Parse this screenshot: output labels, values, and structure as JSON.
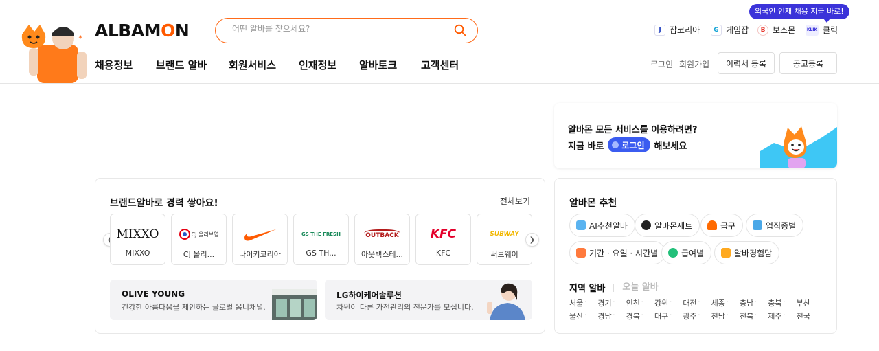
{
  "header": {
    "logo": "ALBAMON",
    "search_placeholder": "어떤 알바를 찾으세요?",
    "promo_badge": "외국인 인재 채용 지금 바로!",
    "family_sites": [
      {
        "label": "잡코리아",
        "icon": "jobkorea-icon",
        "color": "#1f3fbf",
        "glyph": "J"
      },
      {
        "label": "게임잡",
        "icon": "gamejob-icon",
        "color": "#15a4d6",
        "glyph": "G"
      },
      {
        "label": "보스몬",
        "icon": "bossmon-icon",
        "color": "#e8342b",
        "glyph": "B"
      },
      {
        "label": "클릭",
        "icon": "klik-icon",
        "color": "#3b33d9",
        "glyph": "KLIK"
      }
    ],
    "nav": [
      "채용정보",
      "브랜드 알바",
      "회원서비스",
      "인재정보",
      "알바토크",
      "고객센터"
    ],
    "login_link": "로그인",
    "signup_link": "회원가입",
    "resume_button": "이력서 등록",
    "post_button": "공고등록"
  },
  "login_card": {
    "line1": "알바몬 모든 서비스를 이용하려면?",
    "line2_before": "지금 바로",
    "login_pill": "로그인",
    "line2_after": "해보세요"
  },
  "brand_section": {
    "title": "브랜드알바로 경력 쌓아요!",
    "more": "전체보기",
    "brands": [
      {
        "name": "MIXXO",
        "logo_text": "MIXXO"
      },
      {
        "name": "CJ 올리...",
        "logo_text": "CJ 올리브영"
      },
      {
        "name": "나이키코리아",
        "logo_text": "nike-swoosh"
      },
      {
        "name": "GS TH...",
        "logo_text": "GS THE FRESH"
      },
      {
        "name": "아웃백스테...",
        "logo_text": "OUTBACK"
      },
      {
        "name": "KFC",
        "logo_text": "KFC"
      },
      {
        "name": "써브웨이",
        "logo_text": "SUBWAY"
      }
    ],
    "banners": [
      {
        "title": "OLIVE YOUNG",
        "subtitle": "건강한 아름다움을 제안하는 글로벌 옴니채널."
      },
      {
        "title": "LG하이케어솔루션",
        "subtitle": "차원이 다른 가전관리의 전문가를 모십니다."
      }
    ]
  },
  "recommend": {
    "title": "알바몬 추천",
    "chips": [
      {
        "label": "AI추천알바",
        "icon": "ai-monitor-icon",
        "color": "#5ab3f0"
      },
      {
        "label": "알바몬제트",
        "icon": "jet-icon",
        "color": "#222222"
      },
      {
        "label": "급구",
        "icon": "siren-icon",
        "color": "#ff6a00"
      },
      {
        "label": "업직종별",
        "icon": "briefcase-icon",
        "color": "#4aa8e8"
      },
      {
        "label": "기간 · 요일 · 시간별",
        "icon": "calendar-icon",
        "color": "#ff7a3d"
      },
      {
        "label": "급여별",
        "icon": "coin-icon",
        "color": "#22c07a"
      },
      {
        "label": "알바경험담",
        "icon": "chat-icon",
        "color": "#ffa91f"
      }
    ],
    "region_tab_active": "지역 알바",
    "region_tab_inactive": "오늘 알바",
    "regions_row1": [
      "서울",
      "경기",
      "인천",
      "강원",
      "대전",
      "세종",
      "충남",
      "충북",
      "부산"
    ],
    "regions_row2": [
      "울산",
      "경남",
      "경북",
      "대구",
      "광주",
      "전남",
      "전북",
      "제주",
      "전국"
    ]
  }
}
